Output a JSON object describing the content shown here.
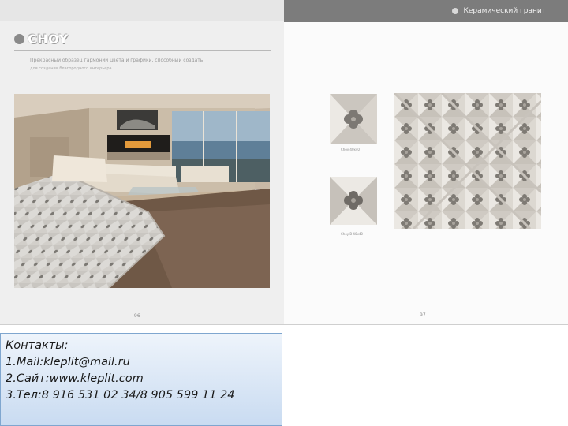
{
  "left_page": {
    "brand": "CHOY",
    "description_line1": "Прекрасный образец гармонии цвета и графики, способный создать",
    "description_line2": "для создания благородного интерьера",
    "page_number": "96"
  },
  "right_page": {
    "category": "Керамический гранит",
    "tile_caption_a": "Choy 40x40",
    "tile_caption_b": "Choy B 40x40",
    "page_number": "97"
  },
  "contacts": {
    "heading": "Контакты:",
    "mail": "1.Mail:kleplit@mail.ru",
    "site": "2.Сайт:www.kleplit.com",
    "phone": "3.Тел:8 916 531 02 34/8 905 599 11 24"
  },
  "colors": {
    "header_band": "#7c7c7c",
    "contacts_border": "#7fa6cf",
    "contacts_fill": "#c9dbf1"
  }
}
